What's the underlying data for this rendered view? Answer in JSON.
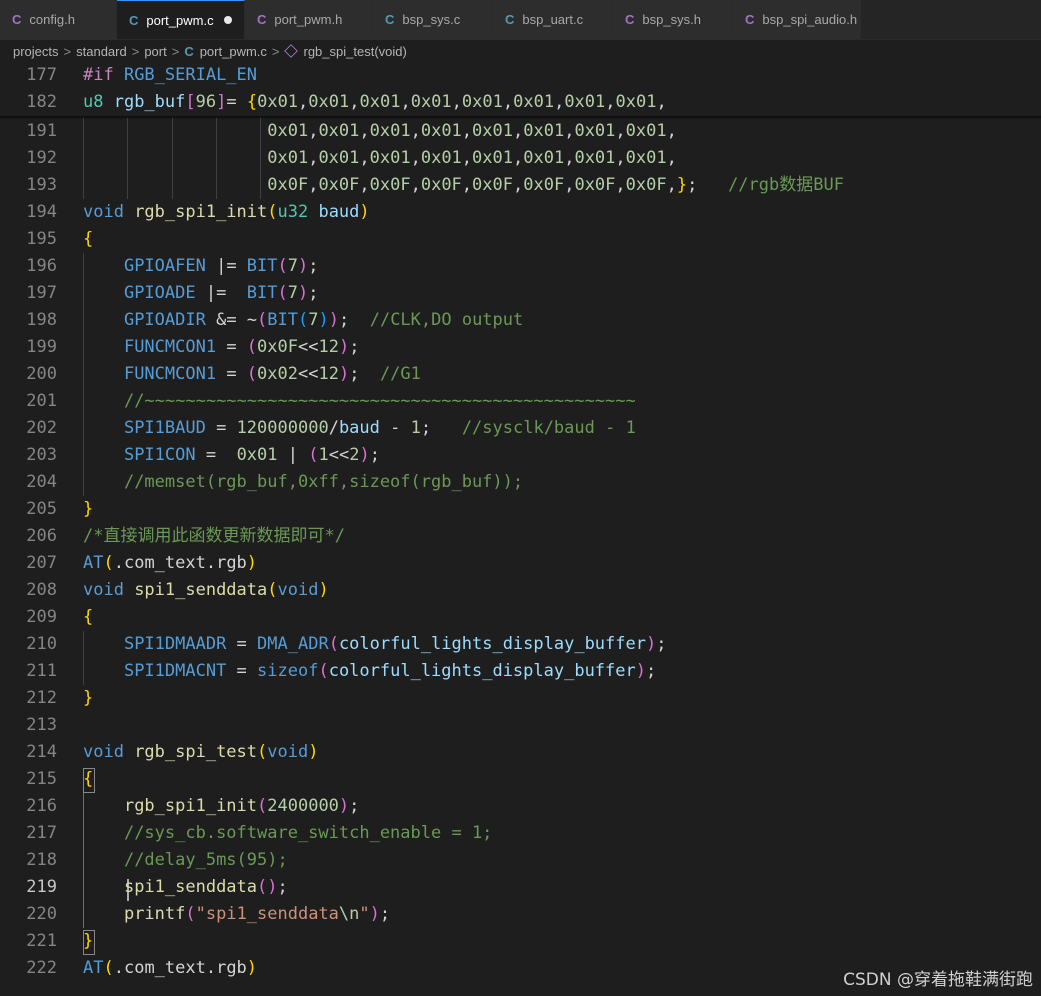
{
  "tabs": [
    {
      "label": "config.h",
      "kind": "h",
      "icon": "C",
      "active": false
    },
    {
      "label": "port_pwm.c",
      "kind": "c",
      "icon": "C",
      "active": true,
      "dirty": true
    },
    {
      "label": "port_pwm.h",
      "kind": "h",
      "icon": "C",
      "active": false
    },
    {
      "label": "bsp_sys.c",
      "kind": "c",
      "icon": "C",
      "active": false
    },
    {
      "label": "bsp_uart.c",
      "kind": "c",
      "icon": "C",
      "active": false
    },
    {
      "label": "bsp_sys.h",
      "kind": "h",
      "icon": "C",
      "active": false
    },
    {
      "label": "bsp_spi_audio.h",
      "kind": "h",
      "icon": "C",
      "active": false
    }
  ],
  "breadcrumb": {
    "items": [
      "projects",
      "standard",
      "port",
      "port_pwm.c",
      "rgb_spi_test(void)"
    ],
    "separator": ">",
    "file_icon": "C"
  },
  "editor": {
    "lines": [
      {
        "n": "177",
        "sticky": true,
        "tokens": [
          [
            "pp",
            "#if "
          ],
          [
            "mac",
            "RGB_SERIAL_EN"
          ]
        ]
      },
      {
        "n": "182",
        "sticky": true,
        "tokens": [
          [
            "ty",
            "u8 "
          ],
          [
            "var",
            "rgb_buf"
          ],
          [
            "b2",
            "["
          ],
          [
            "num",
            "96"
          ],
          [
            "b2",
            "]"
          ],
          [
            "",
            "="
          ],
          [
            "b1",
            " {"
          ],
          [
            "num",
            "0x01"
          ],
          [
            "",
            ","
          ],
          [
            "num",
            "0x01"
          ],
          [
            "",
            ","
          ],
          [
            "num",
            "0x01"
          ],
          [
            "",
            ","
          ],
          [
            "num",
            "0x01"
          ],
          [
            "",
            ","
          ],
          [
            "num",
            "0x01"
          ],
          [
            "",
            ","
          ],
          [
            "num",
            "0x01"
          ],
          [
            "",
            ","
          ],
          [
            "num",
            "0x01"
          ],
          [
            "",
            ","
          ],
          [
            "num",
            "0x01"
          ],
          [
            "",
            ","
          ]
        ]
      },
      {
        "n": "191",
        "tokens": [
          [
            "",
            "                  "
          ],
          [
            "num",
            "0x01"
          ],
          [
            "",
            ","
          ],
          [
            "num",
            "0x01"
          ],
          [
            "",
            ","
          ],
          [
            "num",
            "0x01"
          ],
          [
            "",
            ","
          ],
          [
            "num",
            "0x01"
          ],
          [
            "",
            ","
          ],
          [
            "num",
            "0x01"
          ],
          [
            "",
            ","
          ],
          [
            "num",
            "0x01"
          ],
          [
            "",
            ","
          ],
          [
            "num",
            "0x01"
          ],
          [
            "",
            ","
          ],
          [
            "num",
            "0x01"
          ],
          [
            "",
            ","
          ]
        ]
      },
      {
        "n": "192",
        "tokens": [
          [
            "",
            "                  "
          ],
          [
            "num",
            "0x01"
          ],
          [
            "",
            ","
          ],
          [
            "num",
            "0x01"
          ],
          [
            "",
            ","
          ],
          [
            "num",
            "0x01"
          ],
          [
            "",
            ","
          ],
          [
            "num",
            "0x01"
          ],
          [
            "",
            ","
          ],
          [
            "num",
            "0x01"
          ],
          [
            "",
            ","
          ],
          [
            "num",
            "0x01"
          ],
          [
            "",
            ","
          ],
          [
            "num",
            "0x01"
          ],
          [
            "",
            ","
          ],
          [
            "num",
            "0x01"
          ],
          [
            "",
            ","
          ]
        ]
      },
      {
        "n": "193",
        "tokens": [
          [
            "",
            "                  "
          ],
          [
            "num",
            "0x0F"
          ],
          [
            "",
            ","
          ],
          [
            "num",
            "0x0F"
          ],
          [
            "",
            ","
          ],
          [
            "num",
            "0x0F"
          ],
          [
            "",
            ","
          ],
          [
            "num",
            "0x0F"
          ],
          [
            "",
            ","
          ],
          [
            "num",
            "0x0F"
          ],
          [
            "",
            ","
          ],
          [
            "num",
            "0x0F"
          ],
          [
            "",
            ","
          ],
          [
            "num",
            "0x0F"
          ],
          [
            "",
            ","
          ],
          [
            "num",
            "0x0F"
          ],
          [
            "",
            ","
          ],
          [
            "b1",
            "}"
          ],
          [
            "",
            ";   "
          ],
          [
            "cm",
            "//rgb数据BUF"
          ]
        ]
      },
      {
        "n": "194",
        "tokens": [
          [
            "kw",
            "void "
          ],
          [
            "fn",
            "rgb_spi1_init"
          ],
          [
            "b1",
            "("
          ],
          [
            "ty",
            "u32 "
          ],
          [
            "var",
            "baud"
          ],
          [
            "b1",
            ")"
          ]
        ]
      },
      {
        "n": "195",
        "tokens": [
          [
            "b1",
            "{"
          ]
        ]
      },
      {
        "n": "196",
        "tokens": [
          [
            "",
            "    "
          ],
          [
            "mac",
            "GPIOAFEN "
          ],
          [
            "",
            "|= "
          ],
          [
            "mac",
            "BIT"
          ],
          [
            "b2",
            "("
          ],
          [
            "num",
            "7"
          ],
          [
            "b2",
            ")"
          ],
          [
            "",
            ";"
          ]
        ]
      },
      {
        "n": "197",
        "tokens": [
          [
            "",
            "    "
          ],
          [
            "mac",
            "GPIOADE "
          ],
          [
            "",
            "|=  "
          ],
          [
            "mac",
            "BIT"
          ],
          [
            "b2",
            "("
          ],
          [
            "num",
            "7"
          ],
          [
            "b2",
            ")"
          ],
          [
            "",
            ";"
          ]
        ]
      },
      {
        "n": "198",
        "tokens": [
          [
            "",
            "    "
          ],
          [
            "mac",
            "GPIOADIR "
          ],
          [
            "",
            "&= ~"
          ],
          [
            "b2",
            "("
          ],
          [
            "mac",
            "BIT"
          ],
          [
            "b3",
            "("
          ],
          [
            "num",
            "7"
          ],
          [
            "b3",
            ")"
          ],
          [
            "b2",
            ")"
          ],
          [
            "",
            ";  "
          ],
          [
            "cm",
            "//CLK,DO output"
          ]
        ]
      },
      {
        "n": "199",
        "tokens": [
          [
            "",
            "    "
          ],
          [
            "mac",
            "FUNCMCON1 "
          ],
          [
            "",
            "= "
          ],
          [
            "b2",
            "("
          ],
          [
            "num",
            "0x0F"
          ],
          [
            "",
            "<<"
          ],
          [
            "num",
            "12"
          ],
          [
            "b2",
            ")"
          ],
          [
            "",
            ";"
          ]
        ]
      },
      {
        "n": "200",
        "tokens": [
          [
            "",
            "    "
          ],
          [
            "mac",
            "FUNCMCON1 "
          ],
          [
            "",
            "= "
          ],
          [
            "b2",
            "("
          ],
          [
            "num",
            "0x02"
          ],
          [
            "",
            "<<"
          ],
          [
            "num",
            "12"
          ],
          [
            "b2",
            ")"
          ],
          [
            "",
            ";  "
          ],
          [
            "cm",
            "//G1"
          ]
        ]
      },
      {
        "n": "201",
        "tokens": [
          [
            "",
            "    "
          ],
          [
            "cm",
            "//~~~~~~~~~~~~~~~~~~~~~~~~~~~~~~~~~~~~~~~~~~~~~~~~"
          ]
        ]
      },
      {
        "n": "202",
        "tokens": [
          [
            "",
            "    "
          ],
          [
            "mac",
            "SPI1BAUD "
          ],
          [
            "",
            "= "
          ],
          [
            "num",
            "120000000"
          ],
          [
            "",
            "/"
          ],
          [
            "var",
            "baud"
          ],
          [
            "",
            " - "
          ],
          [
            "num",
            "1"
          ],
          [
            "",
            ";   "
          ],
          [
            "cm",
            "//sysclk/baud - 1"
          ]
        ]
      },
      {
        "n": "203",
        "tokens": [
          [
            "",
            "    "
          ],
          [
            "mac",
            "SPI1CON "
          ],
          [
            "",
            "=  "
          ],
          [
            "num",
            "0x01"
          ],
          [
            "",
            " | "
          ],
          [
            "b2",
            "("
          ],
          [
            "num",
            "1"
          ],
          [
            "",
            "<<"
          ],
          [
            "num",
            "2"
          ],
          [
            "b2",
            ")"
          ],
          [
            "",
            ";"
          ]
        ]
      },
      {
        "n": "204",
        "tokens": [
          [
            "",
            "    "
          ],
          [
            "cm",
            "//memset(rgb_buf,0xff,sizeof(rgb_buf));"
          ]
        ]
      },
      {
        "n": "205",
        "tokens": [
          [
            "b1",
            "}"
          ]
        ]
      },
      {
        "n": "206",
        "tokens": [
          [
            "cm",
            "/*直接调用此函数更新数据即可*/"
          ]
        ]
      },
      {
        "n": "207",
        "tokens": [
          [
            "mac",
            "AT"
          ],
          [
            "b1",
            "("
          ],
          [
            "",
            ".com_text.rgb"
          ],
          [
            "b1",
            ")"
          ]
        ]
      },
      {
        "n": "208",
        "tokens": [
          [
            "kw",
            "void "
          ],
          [
            "fn",
            "spi1_senddata"
          ],
          [
            "b1",
            "("
          ],
          [
            "kw",
            "void"
          ],
          [
            "b1",
            ")"
          ]
        ]
      },
      {
        "n": "209",
        "tokens": [
          [
            "b1",
            "{"
          ]
        ]
      },
      {
        "n": "210",
        "tokens": [
          [
            "",
            "    "
          ],
          [
            "mac",
            "SPI1DMAADR "
          ],
          [
            "",
            "= "
          ],
          [
            "mac",
            "DMA_ADR"
          ],
          [
            "b2",
            "("
          ],
          [
            "var",
            "colorful_lights_display_buffer"
          ],
          [
            "b2",
            ")"
          ],
          [
            "",
            ";"
          ]
        ]
      },
      {
        "n": "211",
        "tokens": [
          [
            "",
            "    "
          ],
          [
            "mac",
            "SPI1DMACNT "
          ],
          [
            "",
            "= "
          ],
          [
            "kw",
            "sizeof"
          ],
          [
            "b2",
            "("
          ],
          [
            "var",
            "colorful_lights_display_buffer"
          ],
          [
            "b2",
            ")"
          ],
          [
            "",
            ";"
          ]
        ]
      },
      {
        "n": "212",
        "tokens": [
          [
            "b1",
            "}"
          ]
        ]
      },
      {
        "n": "213",
        "tokens": []
      },
      {
        "n": "214",
        "tokens": [
          [
            "kw",
            "void "
          ],
          [
            "fn",
            "rgb_spi_test"
          ],
          [
            "b1",
            "("
          ],
          [
            "kw",
            "void"
          ],
          [
            "b1",
            ")"
          ]
        ]
      },
      {
        "n": "215",
        "tokens": [
          [
            "b1",
            "{"
          ]
        ]
      },
      {
        "n": "216",
        "tokens": [
          [
            "",
            "    "
          ],
          [
            "fn",
            "rgb_spi1_init"
          ],
          [
            "b2",
            "("
          ],
          [
            "num",
            "2400000"
          ],
          [
            "b2",
            ")"
          ],
          [
            "",
            ";"
          ]
        ]
      },
      {
        "n": "217",
        "tokens": [
          [
            "",
            "    "
          ],
          [
            "cm",
            "//sys_cb.software_switch_enable = 1;"
          ]
        ]
      },
      {
        "n": "218",
        "tokens": [
          [
            "",
            "    "
          ],
          [
            "cm",
            "//delay_5ms(95);"
          ]
        ]
      },
      {
        "n": "219",
        "current": true,
        "tokens": [
          [
            "",
            "    "
          ],
          [
            "fn",
            "spi1_senddata"
          ],
          [
            "b2",
            "("
          ],
          [
            "b2",
            ")"
          ],
          [
            "",
            ";"
          ]
        ]
      },
      {
        "n": "220",
        "tokens": [
          [
            "",
            "    "
          ],
          [
            "fn",
            "printf"
          ],
          [
            "b2",
            "("
          ],
          [
            "str",
            "\"spi1_senddata"
          ],
          [
            "num",
            "\\n"
          ],
          [
            "str",
            "\""
          ],
          [
            "b2",
            ")"
          ],
          [
            "",
            ";"
          ]
        ]
      },
      {
        "n": "221",
        "tokens": [
          [
            "b1",
            "}"
          ]
        ]
      },
      {
        "n": "222",
        "tokens": [
          [
            "mac",
            "AT"
          ],
          [
            "b1",
            "("
          ],
          [
            "",
            ".com_text.rgb"
          ],
          [
            "b1",
            ")"
          ]
        ]
      }
    ]
  },
  "watermark": "CSDN @穿着拖鞋满街跑",
  "colors": {
    "background": "#1e1e1e",
    "keyword": "#569cd6",
    "function": "#dcdcaa",
    "comment": "#6a9955",
    "number": "#b5cea8",
    "type": "#4ec9b0",
    "bracket1": "#ffd700",
    "bracket2": "#da70d6"
  }
}
